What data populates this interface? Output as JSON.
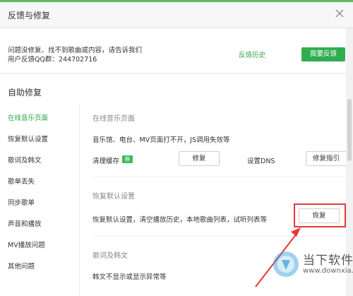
{
  "window": {
    "title": "反馈与修复"
  },
  "feedback": {
    "line1": "问题没修复、找不到歌曲或内容，请告诉我们",
    "line2": "用户反馈QQ群：244702716",
    "history_link": "反馈历史",
    "feedback_button": "我要反馈"
  },
  "auto_repair": {
    "title": "自助修复"
  },
  "sidebar": {
    "items": [
      {
        "label": "在线音乐页面",
        "active": true
      },
      {
        "label": "恢复默认设置",
        "active": false
      },
      {
        "label": "歌词及韩文",
        "active": false
      },
      {
        "label": "歌单丢失",
        "active": false
      },
      {
        "label": "同步歌单",
        "active": false
      },
      {
        "label": "声音和播放",
        "active": false
      },
      {
        "label": "MV播放问题",
        "active": false
      },
      {
        "label": "其他问题",
        "active": false
      }
    ]
  },
  "sections": {
    "online": {
      "title": "在线音乐页面",
      "desc": "音乐馆、电台、MV页面打不开，JS调用失效等",
      "clear_cache_label": "清理缓存",
      "badge": "荐",
      "repair_button": "修复",
      "dns_label": "设置DNS",
      "guide_button": "修复指引"
    },
    "restore": {
      "title": "恢复默认设置",
      "desc": "恢复默认设置，清空播放历史，本地歌曲列表，试听列表等",
      "restore_button": "恢复"
    },
    "lyrics": {
      "title": "歌词及韩文",
      "desc": "韩文不显示或显示异常等"
    }
  },
  "watermark": {
    "brand": "当下软件园",
    "site": "www.downxia.com"
  },
  "colors": {
    "accent": "#2ea34a",
    "highlight": "#e53935"
  }
}
